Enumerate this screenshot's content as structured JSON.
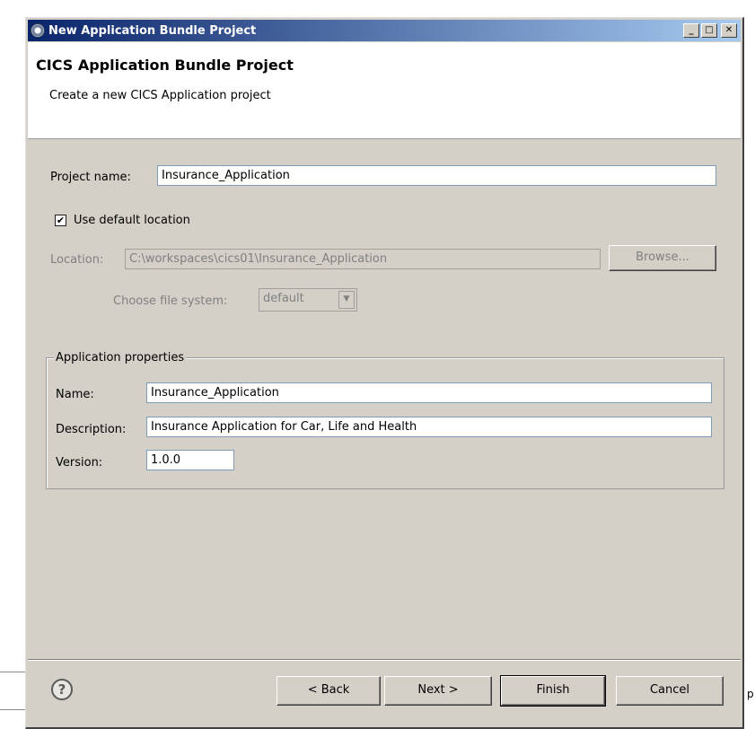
{
  "background": {
    "partial_text": "p"
  },
  "window": {
    "title": "New Application Bundle Project",
    "title_icon": "gear-icon",
    "controls": {
      "minimize": "_",
      "maximize": "□",
      "close": "✕"
    }
  },
  "banner": {
    "title": "CICS Application Bundle Project",
    "description": "Create a new CICS Application project"
  },
  "project": {
    "name_label": "Project name:",
    "name_value": "Insurance_Application",
    "use_default_label": "Use default location",
    "use_default_checked": true,
    "check_mark": "✔",
    "location_label": "Location:",
    "location_value": "C:\\workspaces\\cics01\\Insurance_Application",
    "browse_label": "Browse...",
    "file_system_label": "Choose file system:",
    "file_system_value": "default",
    "file_system_arrow": "▼"
  },
  "app_properties": {
    "legend": "Application properties",
    "name_label": "Name:",
    "name_value": "Insurance_Application",
    "description_label": "Description:",
    "description_value": "Insurance Application for Car, Life and Health",
    "version_label": "Version:",
    "version_value": "1.0.0"
  },
  "footer": {
    "help_icon": "help-icon",
    "help_glyph": "?",
    "back_label": "< Back",
    "next_label": "Next >",
    "finish_label": "Finish",
    "cancel_label": "Cancel"
  },
  "colors": {
    "titlebar_start": "#0a246a",
    "titlebar_end": "#a6caf0",
    "dialog_bg": "#d4d0c8",
    "field_border": "#7f9db9"
  }
}
